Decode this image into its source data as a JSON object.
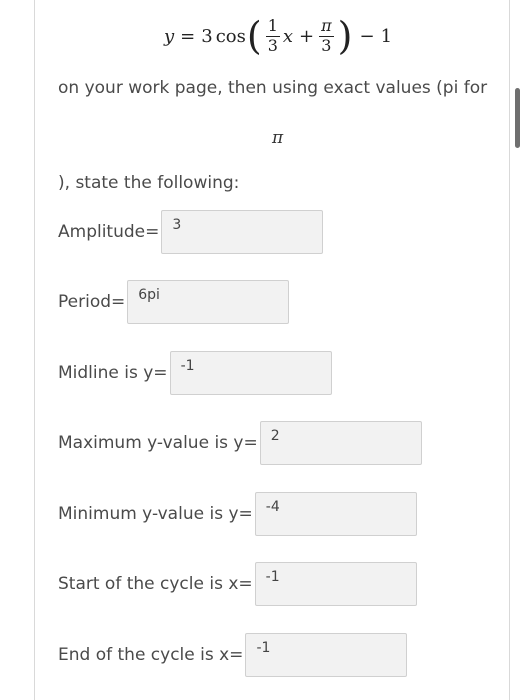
{
  "equation": {
    "lhs": "y",
    "equals": "=",
    "coef": "3",
    "func": "cos",
    "frac1_num": "1",
    "frac1_den": "3",
    "var": "x",
    "plus": "+",
    "frac2_num": "π",
    "frac2_den": "3",
    "minus": "−",
    "const": "1"
  },
  "instructions": {
    "line1": "on your work page, then using exact values (pi for",
    "pi_symbol": "π",
    "line2": "), state the following:"
  },
  "fields": [
    {
      "label": "Amplitude=",
      "value": "3"
    },
    {
      "label": "Period=",
      "value": "6pi"
    },
    {
      "label": "Midline is y=",
      "value": "-1"
    },
    {
      "label": "Maximum y-value is y=",
      "value": "2"
    },
    {
      "label": "Minimum y-value is y=",
      "value": "-4"
    },
    {
      "label": "Start of the cycle is x=",
      "value": "-1"
    },
    {
      "label": "End of the cycle is x=",
      "value": "-1"
    }
  ]
}
